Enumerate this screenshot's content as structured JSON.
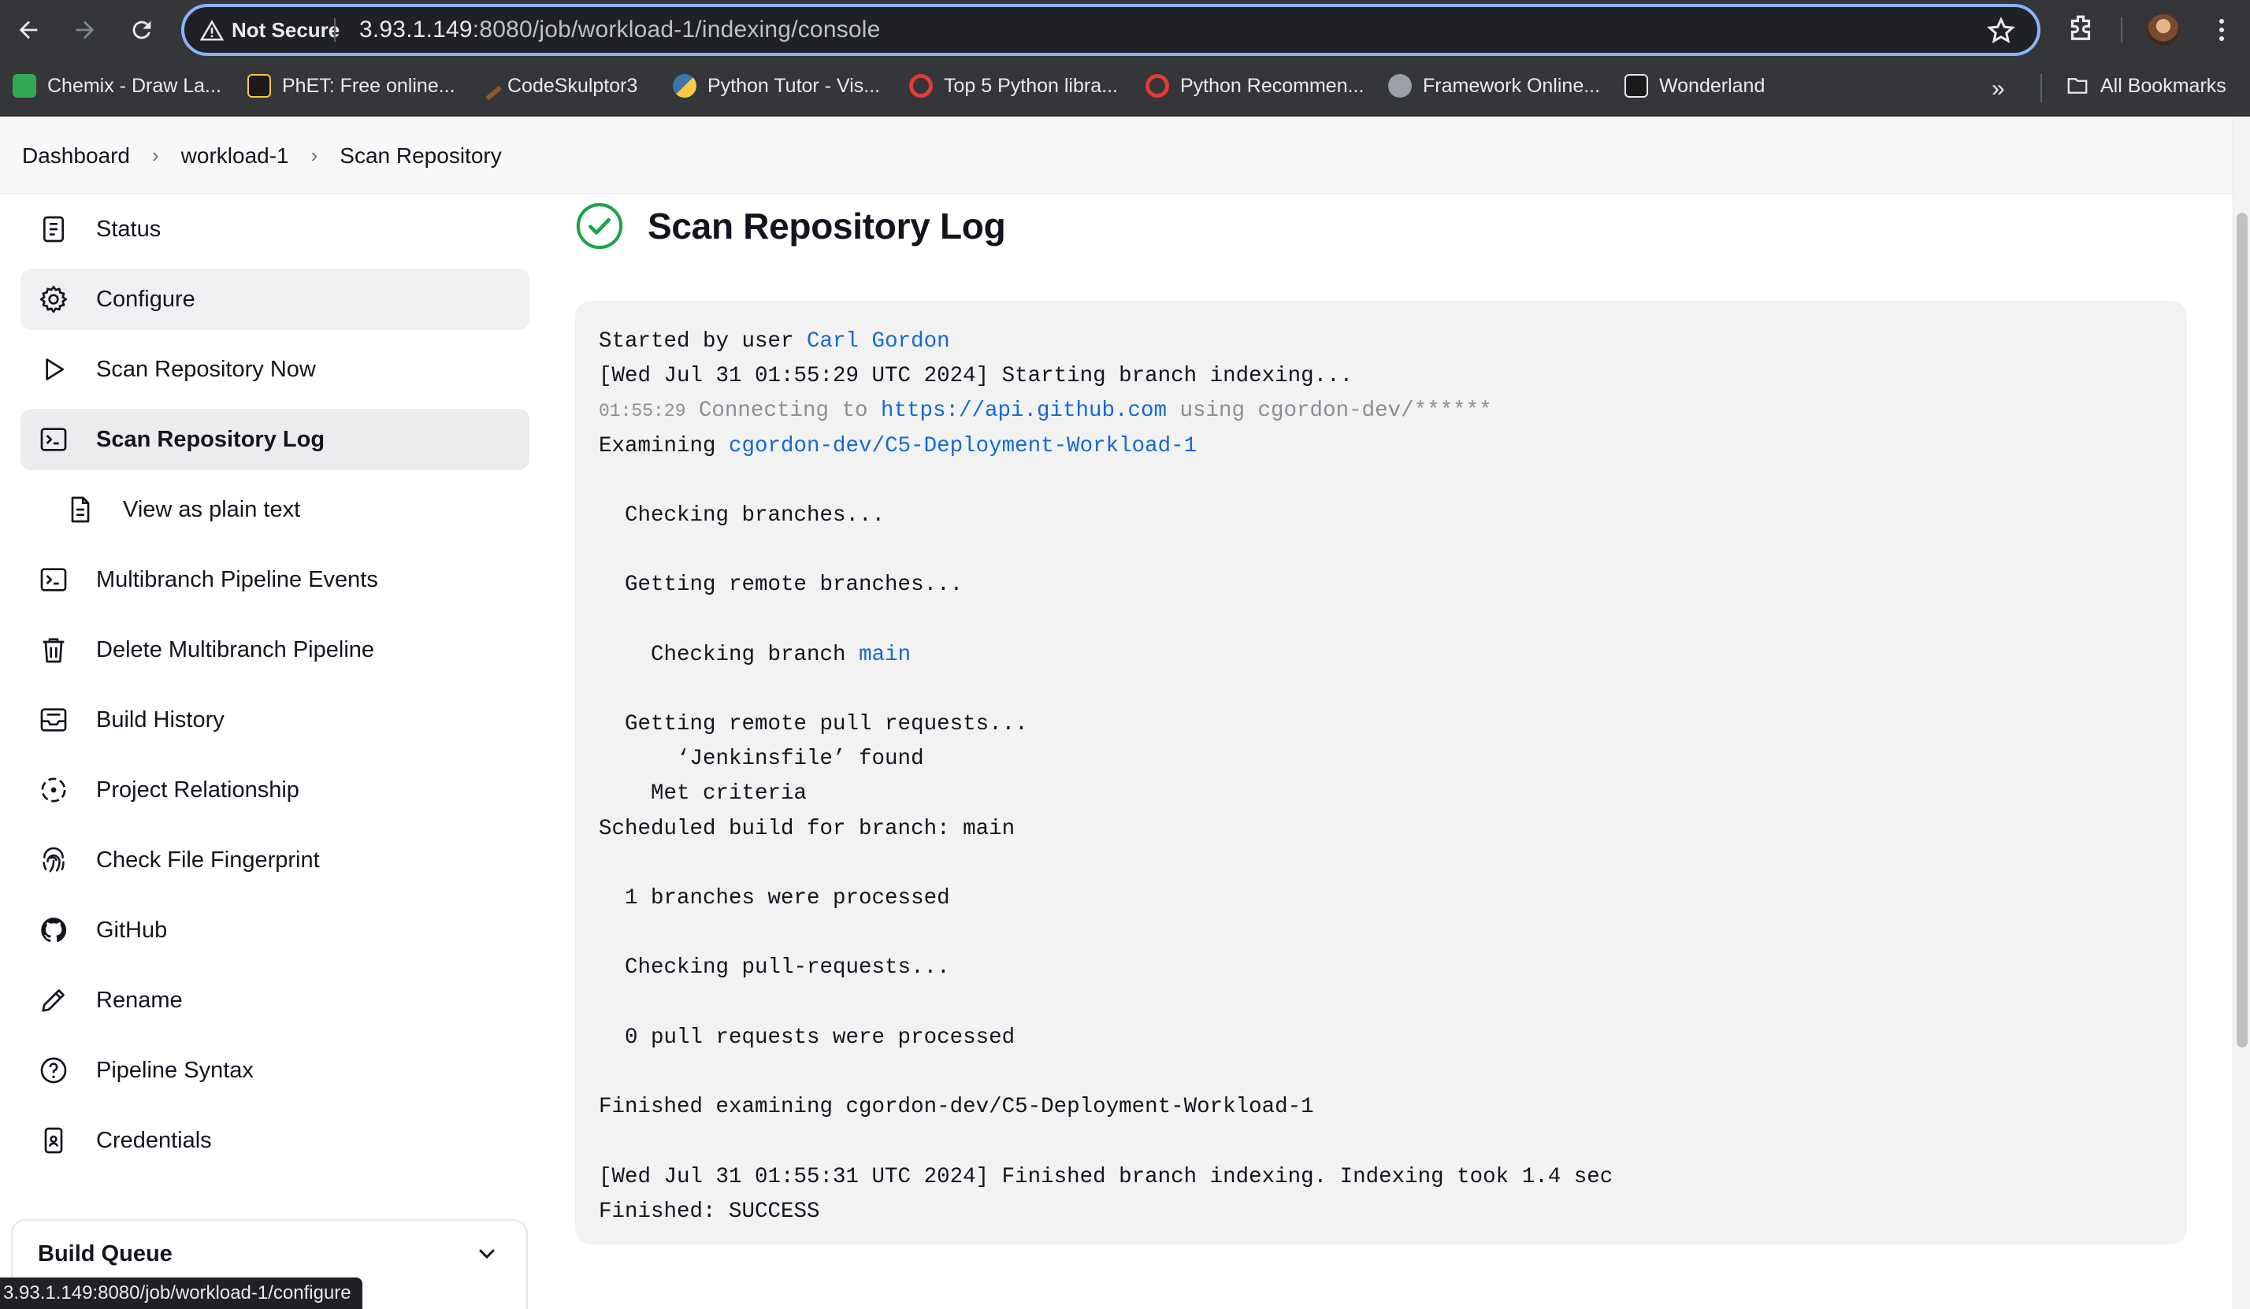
{
  "browser": {
    "security_label": "Not Secure",
    "url_host": "3.93.1.149",
    "url_path": ":8080/job/workload-1/indexing/console",
    "bookmarks": [
      {
        "label": "Chemix - Draw La...",
        "color": "#34a853"
      },
      {
        "label": "PhET: Free online...",
        "color": "#1a1a1a"
      },
      {
        "label": "CodeSkulptor3",
        "color": "#8b5a2b"
      },
      {
        "label": "Python Tutor - Vis...",
        "color": "#f7c948"
      },
      {
        "label": "Top 5 Python libra...",
        "color": "#e53935"
      },
      {
        "label": "Python Recommen...",
        "color": "#e53935"
      },
      {
        "label": "Framework Online...",
        "color": "#9aa0a6"
      },
      {
        "label": "Wonderland",
        "color": "#1a1a1a"
      }
    ],
    "all_bookmarks_label": "All Bookmarks",
    "status_url": "3.93.1.149:8080/job/workload-1/configure"
  },
  "breadcrumb": [
    "Dashboard",
    "workload-1",
    "Scan Repository"
  ],
  "sidebar": {
    "items": [
      {
        "label": "Status",
        "icon": "status-document-icon"
      },
      {
        "label": "Configure",
        "icon": "gear-icon"
      },
      {
        "label": "Scan Repository Now",
        "icon": "play-icon"
      },
      {
        "label": "Scan Repository Log",
        "icon": "terminal-icon"
      },
      {
        "label": "View as plain text",
        "icon": "document-icon"
      },
      {
        "label": "Multibranch Pipeline Events",
        "icon": "terminal-icon"
      },
      {
        "label": "Delete Multibranch Pipeline",
        "icon": "trash-icon"
      },
      {
        "label": "Build History",
        "icon": "inbox-icon"
      },
      {
        "label": "Project Relationship",
        "icon": "relationship-icon"
      },
      {
        "label": "Check File Fingerprint",
        "icon": "fingerprint-icon"
      },
      {
        "label": "GitHub",
        "icon": "github-icon"
      },
      {
        "label": "Rename",
        "icon": "pencil-icon"
      },
      {
        "label": "Pipeline Syntax",
        "icon": "help-circle-icon"
      },
      {
        "label": "Credentials",
        "icon": "credentials-icon"
      }
    ],
    "build_queue_label": "Build Queue"
  },
  "main": {
    "title": "Scan Repository Log",
    "status_color": "#1ea446",
    "log": {
      "l1_prefix": "Started by user ",
      "l1_user": "Carl Gordon",
      "l2": "[Wed Jul 31 01:55:29 UTC 2024] Starting branch indexing...",
      "l3_time": "01:55:29",
      "l3_prefix": " Connecting to ",
      "l3_link": "https://api.github.com",
      "l3_suffix": " using cgordon-dev/******",
      "l4_prefix": "Examining ",
      "l4_link": "cgordon-dev/C5-Deployment-Workload-1",
      "l6": "  Checking branches...",
      "l8": "  Getting remote branches...",
      "l10_prefix": "    Checking branch ",
      "l10_link": "main",
      "l12": "  Getting remote pull requests...",
      "l13": "      ‘Jenkinsfile’ found",
      "l14": "    Met criteria",
      "l15": "Scheduled build for branch: main",
      "l17": "  1 branches were processed",
      "l19": "  Checking pull-requests...",
      "l21": "  0 pull requests were processed",
      "l23": "Finished examining cgordon-dev/C5-Deployment-Workload-1",
      "l25": "[Wed Jul 31 01:55:31 UTC 2024] Finished branch indexing. Indexing took 1.4 sec",
      "l26": "Finished: SUCCESS"
    }
  }
}
